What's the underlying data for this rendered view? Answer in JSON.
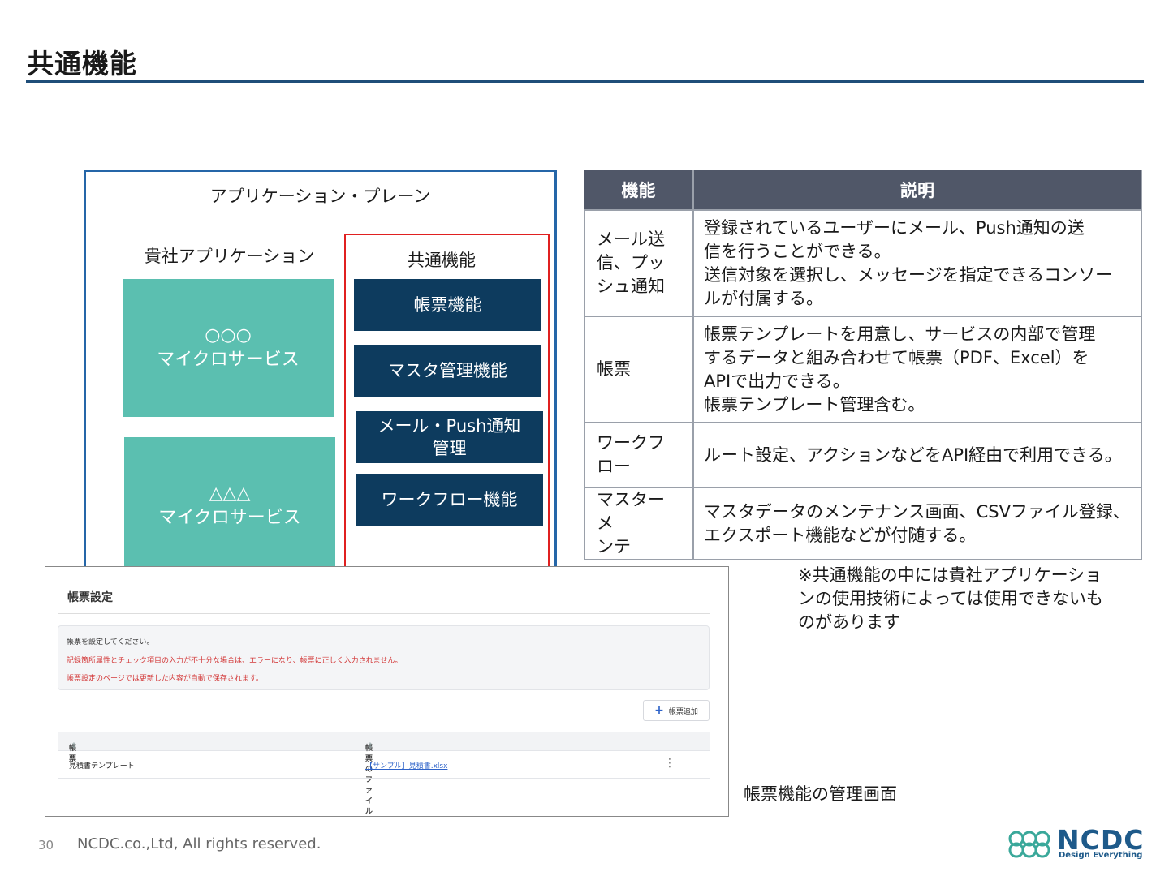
{
  "page": {
    "title": "共通機能"
  },
  "diagram": {
    "plane_label": "アプリケーション・プレーン",
    "client_label": "貴社アプリケーション",
    "services": [
      {
        "symbol": "○○○",
        "name": "マイクロサービス"
      },
      {
        "symbol": "△△△",
        "name": "マイクロサービス"
      }
    ],
    "common_label": "共通機能",
    "features": [
      {
        "line1": "帳票機能",
        "line2": ""
      },
      {
        "line1": "マスタ管理機能",
        "line2": ""
      },
      {
        "line1": "メール・Push通知",
        "line2": "管理"
      },
      {
        "line1": "ワークフロー機能",
        "line2": ""
      }
    ]
  },
  "table": {
    "headers": [
      "機能",
      "説明"
    ],
    "rows": [
      {
        "feature": [
          "メール送",
          "信、プッ",
          "シュ通知"
        ],
        "desc": [
          "登録されているユーザーにメール、Push通知の送",
          "信を行うことができる。",
          "送信対象を選択し、メッセージを指定できるコンソー",
          "ルが付属する。"
        ]
      },
      {
        "feature": [
          "帳票"
        ],
        "desc": [
          "帳票テンプレートを用意し、サービスの内部で管理",
          "するデータと組み合わせて帳票（PDF、Excel）を",
          "APIで出力できる。",
          "帳票テンプレート管理含む。"
        ]
      },
      {
        "feature": [
          "ワークフ",
          "ロー"
        ],
        "desc": [
          "ルート設定、アクションなどをAPI経由で利用できる。"
        ]
      },
      {
        "feature": [
          "マスターメ",
          "ンテ"
        ],
        "desc": [
          "マスタデータのメンテナンス画面、CSVファイル登録、",
          "エクスポート機能などが付随する。"
        ]
      }
    ]
  },
  "note": [
    "※共通機能の中には貴社アプリケーショ",
    "ンの使用技術によっては使用できないも",
    "のがあります"
  ],
  "screenshot": {
    "title": "帳票設定",
    "alert": [
      "帳票を設定してください。",
      "記録箇所属性とチェック項目の入力が不十分な場合は、エラーになり、帳票に正しく入力されません。",
      "帳票設定のページでは更新した内容が自動で保存されます。"
    ],
    "add_button": "帳票追加",
    "columns": [
      "帳票",
      "帳票のファイル名"
    ],
    "sort_icon": "⇕",
    "rows": [
      {
        "name": "見積書テンプレート",
        "file": "【サンプル】見積書.xlsx"
      }
    ],
    "kebab": "⋮"
  },
  "caption": "帳票機能の管理画面",
  "footer": {
    "page_number": "30",
    "copyright": "NCDC.co.,Ltd, All rights reserved."
  },
  "logo": {
    "name": "NCDC",
    "tagline": "Design Everything"
  },
  "colors": {
    "accent": "#1f4e79",
    "teal": "#5bbfb0",
    "navy": "#0d3b5e",
    "red": "#e02020",
    "table_header": "#505768"
  }
}
